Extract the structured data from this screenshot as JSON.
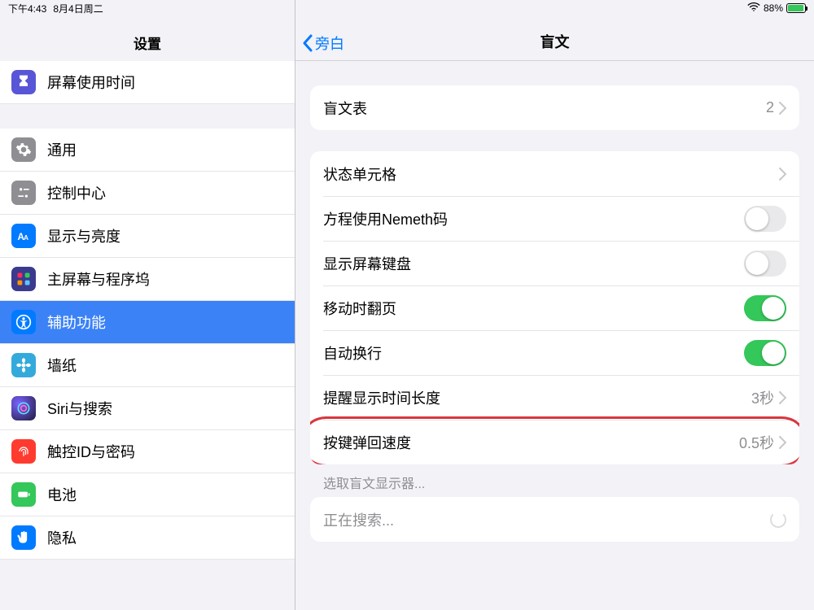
{
  "statusbar": {
    "time": "下午4:43",
    "date": "8月4日周二",
    "battery_percent": "88%"
  },
  "sidebar": {
    "title": "设置",
    "items": {
      "screen_time": "屏幕使用时间",
      "general": "通用",
      "control_center": "控制中心",
      "display": "显示与亮度",
      "home_screen": "主屏幕与程序坞",
      "accessibility": "辅助功能",
      "wallpaper": "墙纸",
      "siri": "Siri与搜索",
      "touchid": "触控ID与密码",
      "battery": "电池",
      "privacy": "隐私"
    }
  },
  "detail": {
    "back_label": "旁白",
    "title": "盲文",
    "groups": {
      "braille_table": {
        "label": "盲文表",
        "value": "2"
      },
      "status_cell": {
        "label": "状态单元格"
      },
      "nemeth": {
        "label": "方程使用Nemeth码",
        "on": false
      },
      "show_keyboard": {
        "label": "显示屏幕键盘",
        "on": false
      },
      "panning": {
        "label": "移动时翻页",
        "on": true
      },
      "word_wrap": {
        "label": "自动换行",
        "on": true
      },
      "alert_duration": {
        "label": "提醒显示时间长度",
        "value": "3秒"
      },
      "key_repeat": {
        "label": "按键弹回速度",
        "value": "0.5秒"
      },
      "choose_display_header": "选取盲文显示器...",
      "searching": "正在搜索..."
    }
  }
}
